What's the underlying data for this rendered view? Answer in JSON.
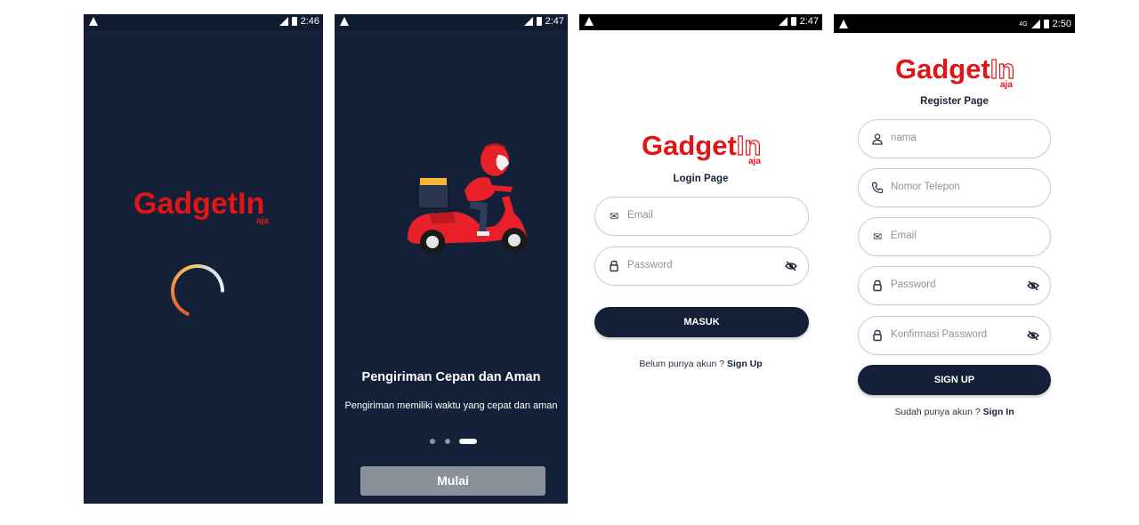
{
  "brand": {
    "name": "GadgetIn",
    "name_main": "Gadget",
    "name_in": "In",
    "sub": "aja",
    "color": "#e01616"
  },
  "colors": {
    "navy": "#132038",
    "muted_button": "#8b919a"
  },
  "screens": {
    "splash": {
      "time": "2:46"
    },
    "onboarding": {
      "time": "2:47",
      "title": "Pengiriman Cepan dan Aman",
      "description": "Pengiriman memiliki waktu yang cepat dan aman",
      "button_label": "Mulai",
      "page_count": 3,
      "active_page": 3
    },
    "login": {
      "time": "2:47",
      "page_title": "Login Page",
      "email_placeholder": "Email",
      "password_placeholder": "Password",
      "submit_label": "MASUK",
      "footer_text": "Belum punya akun ?",
      "footer_link": "Sign Up"
    },
    "register": {
      "time": "2:50",
      "network": "4G",
      "page_title": "Register Page",
      "name_placeholder": "nama",
      "phone_placeholder": "Nomor Telepon",
      "email_placeholder": "Email",
      "password_placeholder": "Password",
      "confirm_placeholder": "Konfirmasi Password",
      "submit_label": "SIGN UP",
      "footer_text": "Sudah punya akun ?",
      "footer_link": "Sign In"
    }
  },
  "icons": {
    "warning": "warning-icon",
    "signal": "signal-icon",
    "battery": "battery-icon",
    "user": "user-icon",
    "phone": "phone-icon",
    "mail": "mail-icon",
    "lock": "lock-icon",
    "eye_off": "eye-off-icon"
  }
}
